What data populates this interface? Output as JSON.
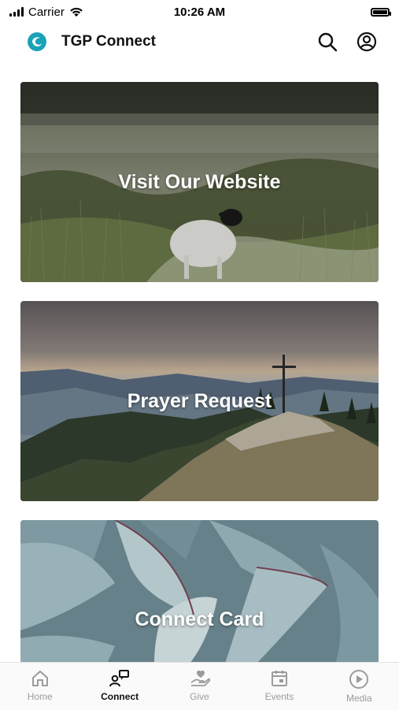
{
  "status_bar": {
    "carrier": "Carrier",
    "time": "10:26 AM"
  },
  "header": {
    "app_title": "TGP Connect",
    "logo": "tgp-logo-icon",
    "icons": [
      "search-icon",
      "account-icon"
    ]
  },
  "cards": [
    {
      "label": "Visit Our Website",
      "image": "sheep-meadow"
    },
    {
      "label": "Prayer Request",
      "image": "mountain-cross"
    },
    {
      "label": "Connect Card",
      "image": "agave-plant"
    }
  ],
  "tab_bar": {
    "items": [
      {
        "label": "Home",
        "icon": "home-icon",
        "active": false
      },
      {
        "label": "Connect",
        "icon": "connect-icon",
        "active": true
      },
      {
        "label": "Give",
        "icon": "give-icon",
        "active": false
      },
      {
        "label": "Events",
        "icon": "calendar-icon",
        "active": false
      },
      {
        "label": "Media",
        "icon": "play-icon",
        "active": false
      }
    ]
  },
  "colors": {
    "accent_logo": "#1aa3b8",
    "active_tab": "#111111",
    "inactive_tab": "#9b9b9b"
  }
}
